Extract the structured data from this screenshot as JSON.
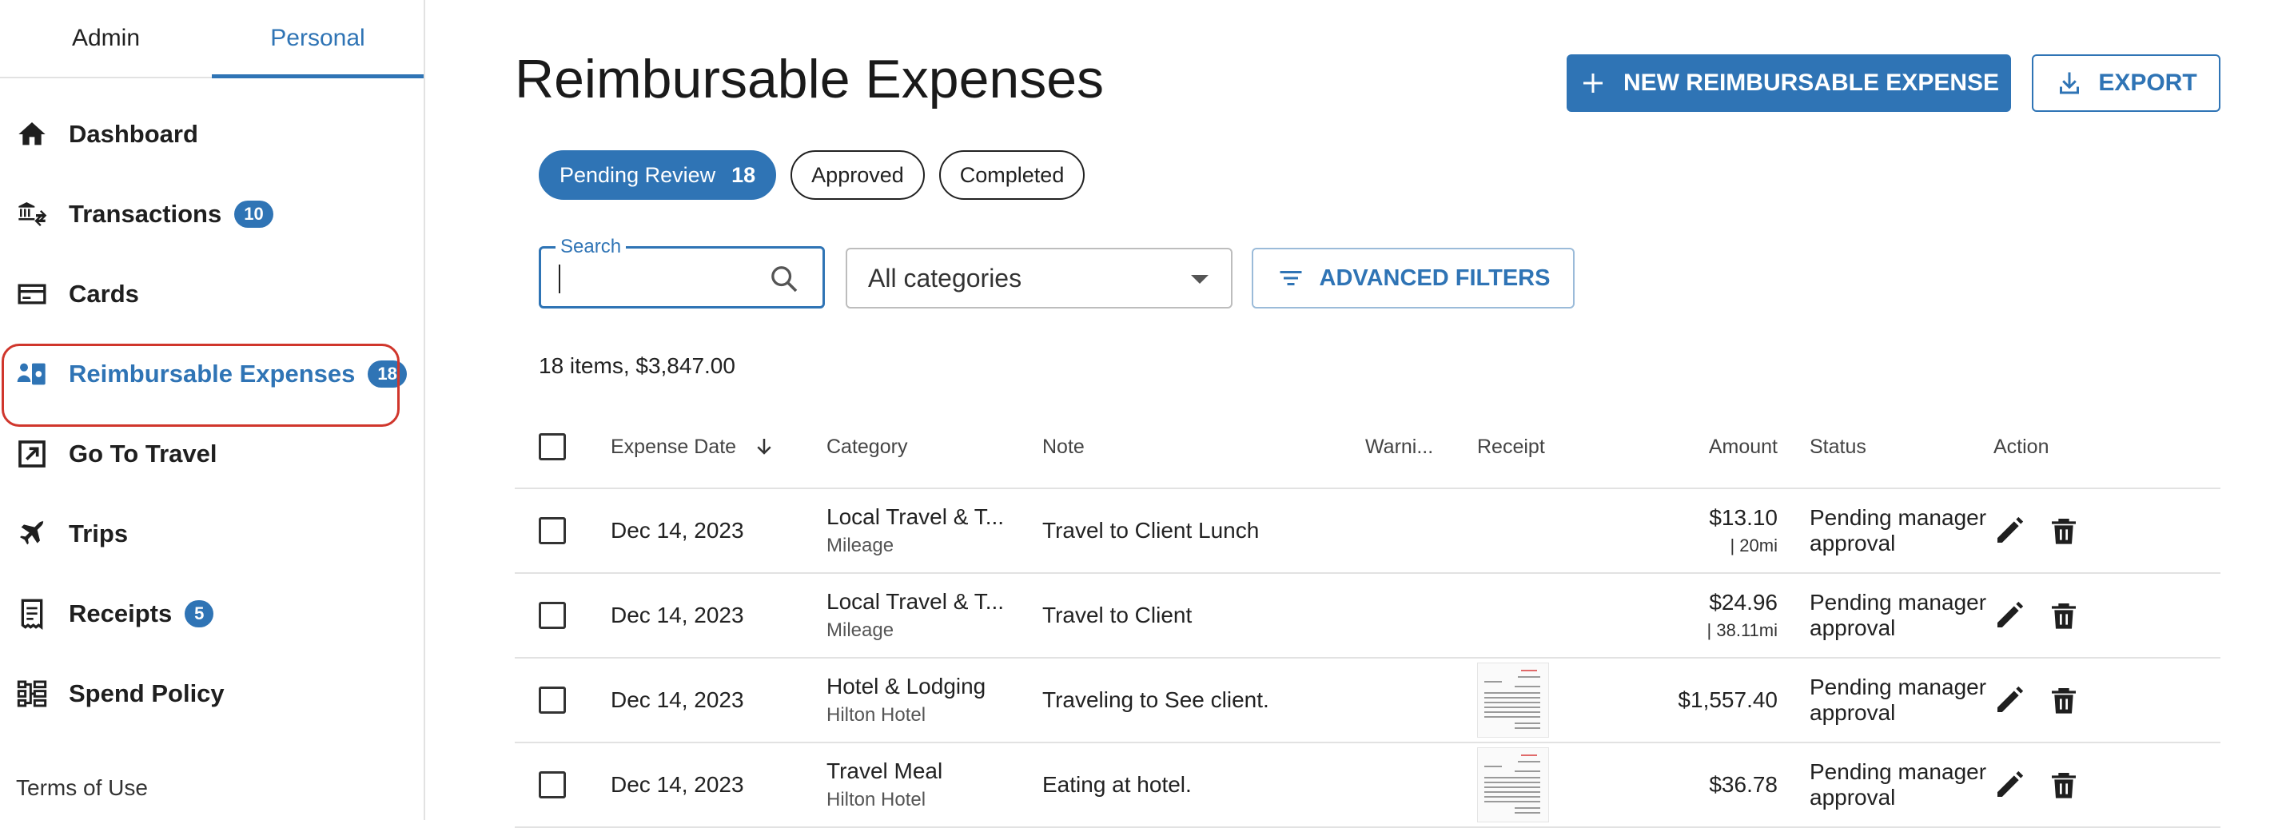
{
  "sidebar": {
    "tabs": [
      {
        "label": "Admin"
      },
      {
        "label": "Personal"
      }
    ],
    "items": [
      {
        "label": "Dashboard",
        "icon": "home-icon"
      },
      {
        "label": "Transactions",
        "badge": "10",
        "icon": "bank-transfer-icon"
      },
      {
        "label": "Cards",
        "icon": "card-icon"
      },
      {
        "label": "Reimbursable Expenses",
        "badge": "18",
        "icon": "reimbursement-icon"
      },
      {
        "label": "Go To Travel",
        "icon": "external-link-icon"
      },
      {
        "label": "Trips",
        "icon": "airplane-icon"
      },
      {
        "label": "Receipts",
        "badge": "5",
        "icon": "receipt-icon"
      },
      {
        "label": "Spend Policy",
        "icon": "policy-icon"
      }
    ],
    "terms": "Terms of Use"
  },
  "header": {
    "title": "Reimbursable Expenses",
    "new_button": "NEW REIMBURSABLE EXPENSE",
    "export_button": "EXPORT"
  },
  "chips": [
    {
      "label": "Pending Review",
      "count": "18"
    },
    {
      "label": "Approved"
    },
    {
      "label": "Completed"
    }
  ],
  "filters": {
    "search_label": "Search",
    "search_value": "",
    "category": "All categories",
    "advanced": "ADVANCED FILTERS"
  },
  "summary": "18 items, $3,847.00",
  "table": {
    "columns": [
      "Expense Date",
      "Category",
      "Note",
      "Warni...",
      "Receipt",
      "Amount",
      "Status",
      "Action"
    ],
    "rows": [
      {
        "date": "Dec 14, 2023",
        "category": "Local Travel & T...",
        "subcategory": "Mileage",
        "note": "Travel to Client Lunch",
        "amount": "$13.10",
        "amount_sub": "|   20mi",
        "status_line1": "Pending manager",
        "status_line2": "approval",
        "receipt": false
      },
      {
        "date": "Dec 14, 2023",
        "category": "Local Travel & T...",
        "subcategory": "Mileage",
        "note": "Travel to Client",
        "amount": "$24.96",
        "amount_sub": "|   38.11mi",
        "status_line1": "Pending manager",
        "status_line2": "approval",
        "receipt": false
      },
      {
        "date": "Dec 14, 2023",
        "category": "Hotel & Lodging",
        "subcategory": "Hilton Hotel",
        "note": "Traveling to See client.",
        "amount": "$1,557.40",
        "amount_sub": "",
        "status_line1": "Pending manager",
        "status_line2": "approval",
        "receipt": true
      },
      {
        "date": "Dec 14, 2023",
        "category": "Travel Meal",
        "subcategory": "Hilton Hotel",
        "note": "Eating at hotel.",
        "amount": "$36.78",
        "amount_sub": "",
        "status_line1": "Pending manager",
        "status_line2": "approval",
        "receipt": true
      }
    ]
  },
  "colors": {
    "accent": "#2f74b5",
    "highlight": "#d0362c"
  }
}
